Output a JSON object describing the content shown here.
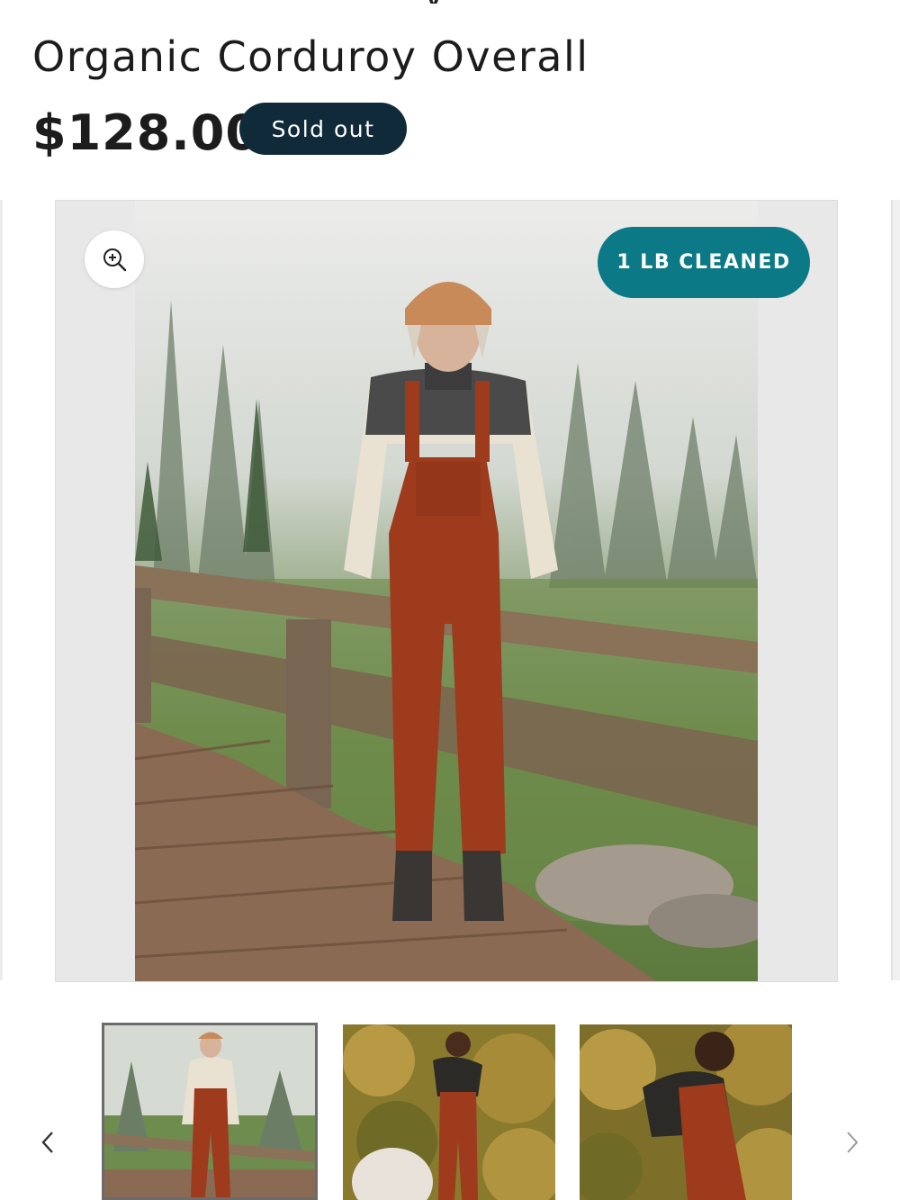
{
  "product": {
    "title": "Organic Corduroy Overall",
    "price": "$128.00",
    "status_badge": "Sold out"
  },
  "media": {
    "zoom_icon": "zoom-in-icon",
    "badge": "1 LB CLEANED",
    "image_alt": "Model wearing rust organic corduroy overalls on a wooden bridge in a misty forest"
  },
  "gallery": {
    "thumbnails": [
      {
        "alt": "Overalls on wooden bridge in misty forest",
        "selected": true
      },
      {
        "alt": "Overalls in front of golden shrubs",
        "selected": false
      },
      {
        "alt": "Overalls side view in front of golden shrubs",
        "selected": false
      }
    ],
    "prev_icon": "chevron-left-icon",
    "next_icon": "chevron-right-icon"
  },
  "colors": {
    "sold_out_bg": "#102a3a",
    "eco_badge_bg": "#0b7a86",
    "overall_rust": "#9e3b1c"
  }
}
